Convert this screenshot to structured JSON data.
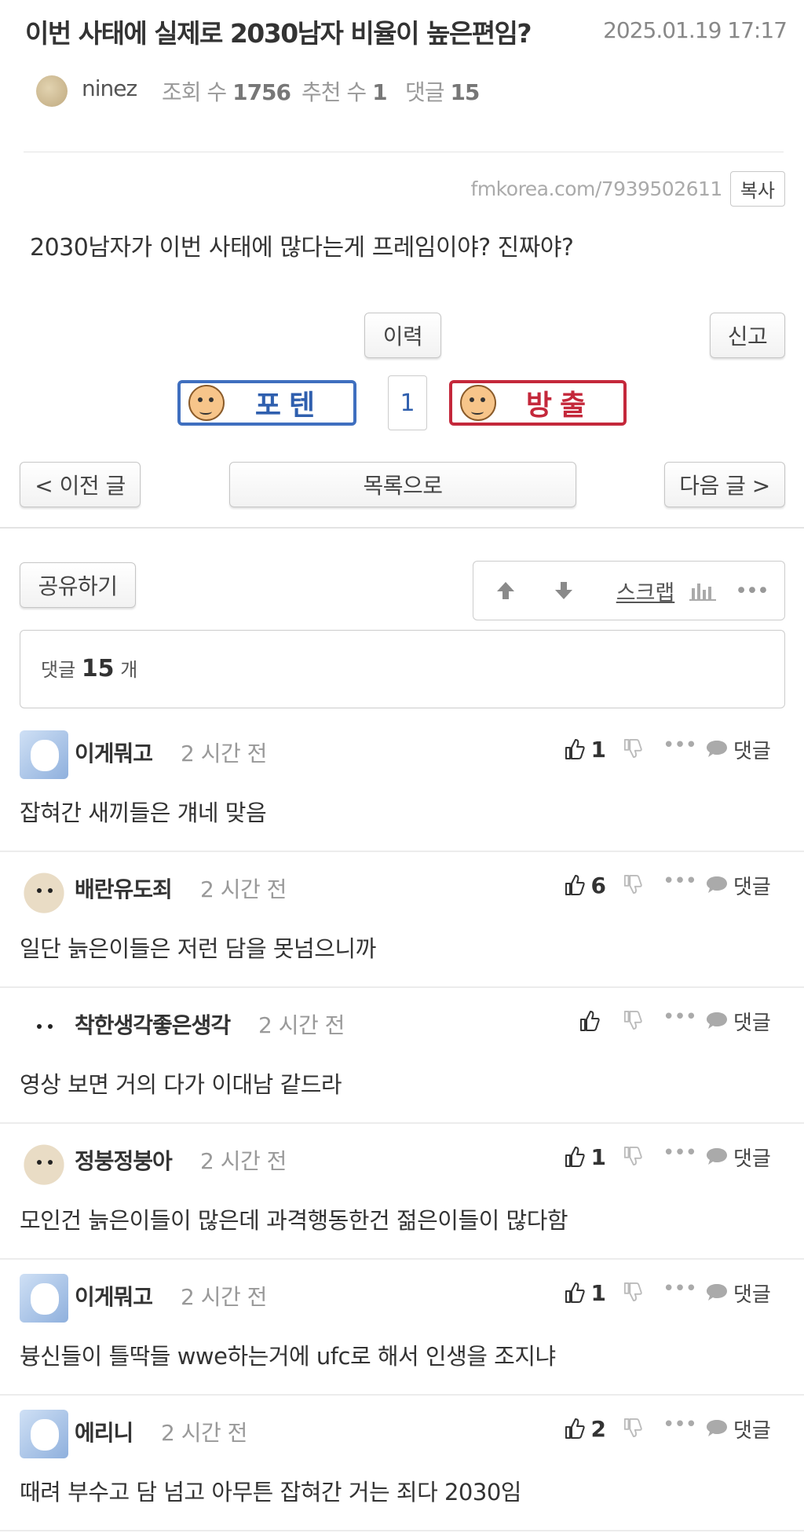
{
  "post": {
    "title": "이번 사태에 실제로 2030남자 비율이 높은편임?",
    "date": "2025.01.19 17:17",
    "author": "ninez",
    "views_label": "조회 수",
    "views": "1756",
    "recommend_label": "추천 수",
    "recommend": "1",
    "comments_label": "댓글",
    "comments": "15",
    "url": "fmkorea.com/7939502611",
    "copy_label": "복사",
    "body": "2030남자가 이번 사태에 많다는게 프레임이야? 진짜야?"
  },
  "actions": {
    "history_label": "이력",
    "report_label": "신고",
    "vote_up_label": "포텐",
    "vote_count": "1",
    "vote_down_label": "방출",
    "prev_label": "< 이전 글",
    "list_label": "목록으로",
    "next_label": "다음 글 >",
    "share_label": "공유하기",
    "scrap_label": "스크랩"
  },
  "comment_section": {
    "count_prefix": "댓글",
    "count": "15",
    "count_suffix": "개",
    "reply_label": "댓글"
  },
  "comments": [
    {
      "author": "이게뭐고",
      "time": "2 시간 전",
      "likes": "1",
      "text": "잡혀간 새끼들은 걔네 맞음"
    },
    {
      "author": "배란유도죄",
      "time": "2 시간 전",
      "likes": "6",
      "text": "일단 늙은이들은 저런 담을 못넘으니까"
    },
    {
      "author": "착한생각좋은생각",
      "time": "2 시간 전",
      "likes": "",
      "text": "영상 보면 거의 다가 이대남 같드라"
    },
    {
      "author": "정붕정붕아",
      "time": "2 시간 전",
      "likes": "1",
      "text": "모인건 늙은이들이 많은데 과격행동한건 젊은이들이 많다함"
    },
    {
      "author": "이게뭐고",
      "time": "2 시간 전",
      "likes": "1",
      "text": "븅신들이 틀딱들 wwe하는거에 ufc로 해서 인생을 조지냐"
    },
    {
      "author": "에리니",
      "time": "2 시간 전",
      "likes": "2",
      "text": "때려 부수고 담 넘고 아무튼 잡혀간 거는 죄다 2030임"
    }
  ],
  "colors": {
    "vote_up": "#3f6fbf",
    "vote_down": "#c4283b"
  }
}
